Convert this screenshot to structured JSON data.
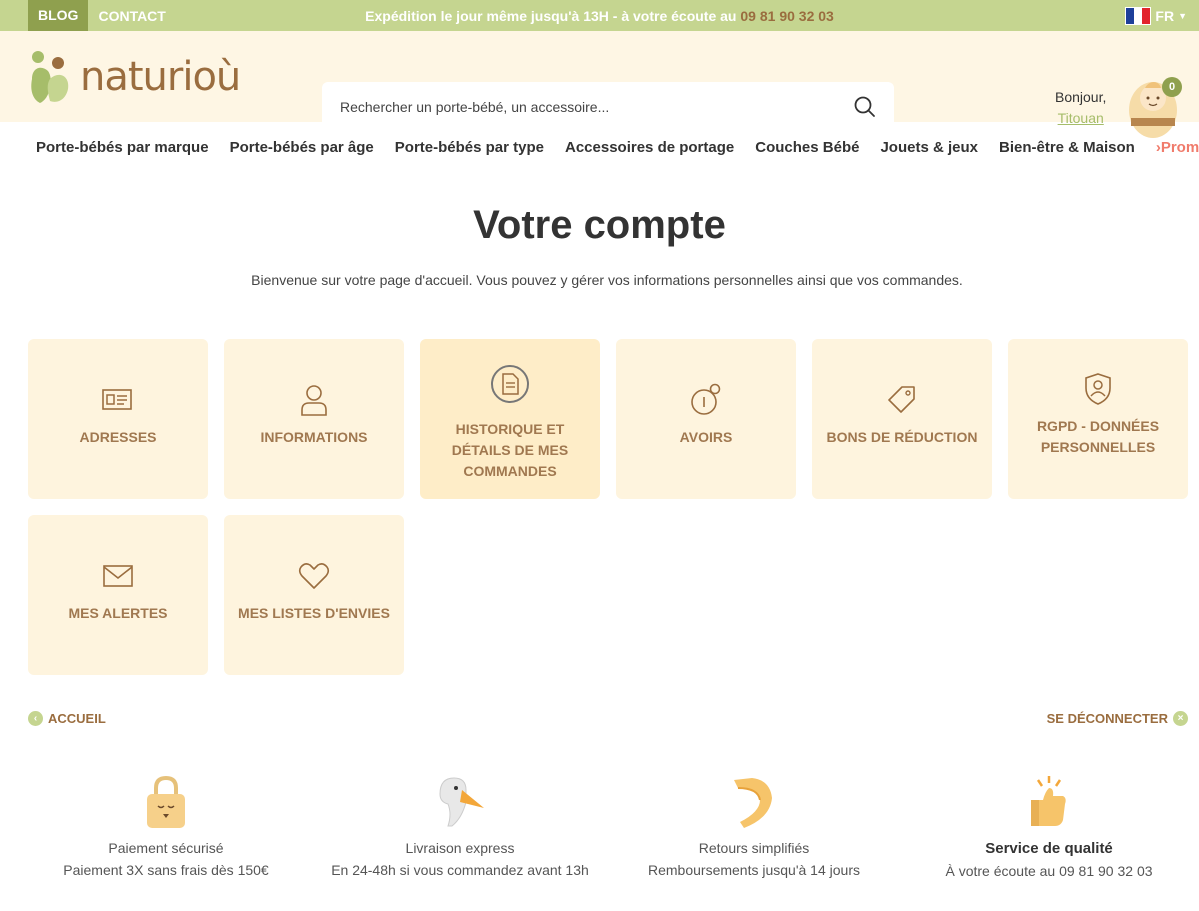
{
  "topbar": {
    "blog": "BLOG",
    "contact": "CONTACT",
    "shipping_text": "Expédition le jour même jusqu'à 13H - à votre écoute au ",
    "shipping_phone": "09 81 90 32 03",
    "language": "FR"
  },
  "header": {
    "logo_text": "naturioù",
    "search_placeholder": "Rechercher un porte-bébé, un accessoire...",
    "greeting": "Bonjour,",
    "username": "Titouan",
    "cart_count": "0"
  },
  "nav": {
    "items": [
      "Porte-bébés par marque",
      "Porte-bébés par âge",
      "Porte-bébés par type",
      "Accessoires de portage",
      "Couches Bébé",
      "Jouets & jeux",
      "Bien-être & Maison"
    ],
    "promo": "Promo"
  },
  "page": {
    "title": "Votre compte",
    "intro": "Bienvenue sur votre page d'accueil. Vous pouvez y gérer vos informations personnelles ainsi que vos commandes."
  },
  "tiles": [
    {
      "label": "ADRESSES",
      "icon": "address-card-icon"
    },
    {
      "label": "INFORMATIONS",
      "icon": "user-icon"
    },
    {
      "label": "HISTORIQUE ET DÉTAILS DE MES COMMANDES",
      "icon": "document-icon"
    },
    {
      "label": "AVOIRS",
      "icon": "credit-slip-icon"
    },
    {
      "label": "BONS DE RÉDUCTION",
      "icon": "tag-icon"
    },
    {
      "label": "RGPD - DONNÉES PERSONNELLES",
      "icon": "shield-user-icon"
    },
    {
      "label": "MES ALERTES",
      "icon": "envelope-icon"
    },
    {
      "label": "MES LISTES D'ENVIES",
      "icon": "heart-icon"
    }
  ],
  "footer_links": {
    "home": "ACCUEIL",
    "logout": "SE DÉCONNECTER"
  },
  "features": [
    {
      "title": "Paiement sécurisé",
      "subtitle": "Paiement 3X sans frais dès 150€",
      "icon": "padlock-icon"
    },
    {
      "title": "Livraison express",
      "subtitle": "En 24-48h si vous commandez avant 13h",
      "icon": "stork-icon"
    },
    {
      "title": "Retours simplifiés",
      "subtitle": "Remboursements jusqu'à 14 jours",
      "icon": "boomerang-icon"
    },
    {
      "title": "Service de qualité",
      "subtitle": "À votre écoute au 09 81 90 32 03",
      "icon": "thumbs-up-icon"
    }
  ],
  "colors": {
    "topbar": "#c5d590",
    "header_bg": "#fef6e4",
    "tile_bg": "#fef4de",
    "tile_text": "#a07850",
    "brown": "#9a6d3f",
    "promo": "#f07b6b"
  }
}
